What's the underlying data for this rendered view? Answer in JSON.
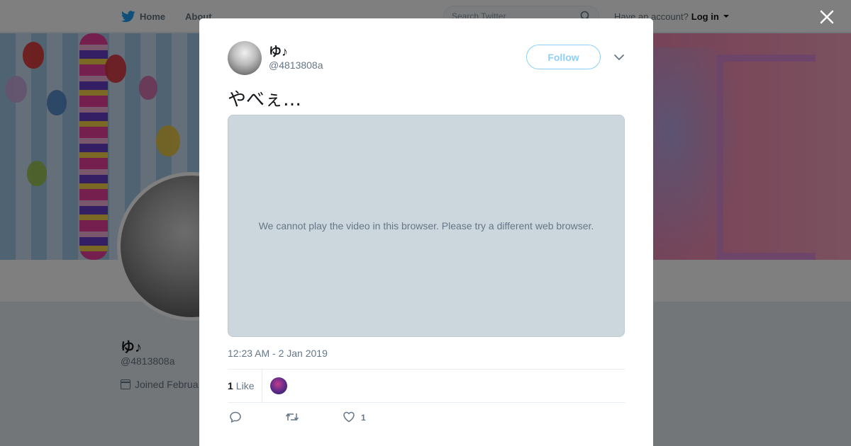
{
  "nav": {
    "home_label": "Home",
    "about_label": "About",
    "search_placeholder": "Search Twitter",
    "have_account_text": "Have an account?",
    "login_label": "Log in"
  },
  "profile": {
    "name": "ゆ♪",
    "handle": "@4813808a",
    "joined_text": "Joined Februa"
  },
  "tweet": {
    "author_name": "ゆ♪",
    "author_handle": "@4813808a",
    "follow_label": "Follow",
    "text": "やべぇ…",
    "media_message": "We cannot play the video in this browser. Please try a different web browser.",
    "timestamp": "12:23 AM - 2 Jan 2019",
    "likes_number": "1",
    "likes_label": "Like",
    "like_action_count": "1"
  },
  "icons": {
    "brand": "twitter-bird-icon",
    "search": "search-icon",
    "close": "close-icon",
    "more": "chevron-down-icon",
    "reply": "reply-icon",
    "retweet": "retweet-icon",
    "like": "heart-icon",
    "calendar": "calendar-icon"
  },
  "colors": {
    "brand_blue": "#1da1f2",
    "text_primary": "#14171a",
    "text_secondary": "#657786",
    "media_background": "#ccd6dd"
  }
}
